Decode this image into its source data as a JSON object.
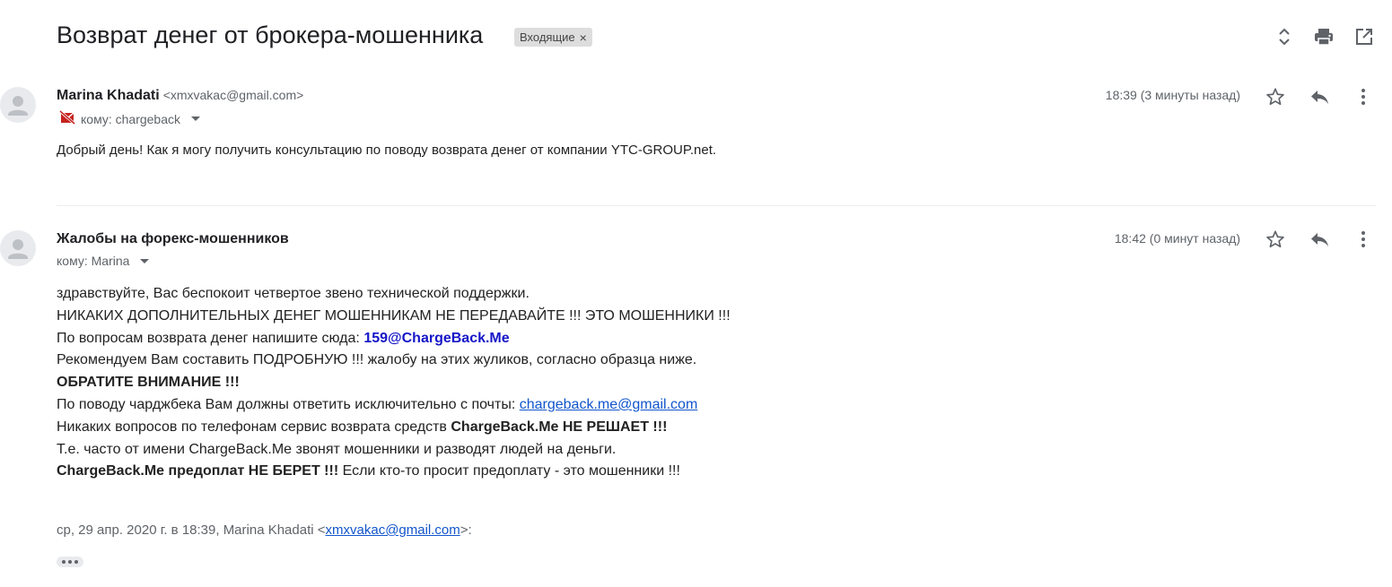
{
  "thread": {
    "subject": "Возврат денег от брокера-мошенника",
    "label": "Входящие",
    "label_remove": "×"
  },
  "toolbar": {
    "icons": [
      "expand-collapse-icon",
      "print-icon",
      "open-new-window-icon"
    ]
  },
  "messages": [
    {
      "sender_name": "Marina Khadati",
      "sender_email": "<xmxvakac@gmail.com>",
      "to": "кому: chargeback",
      "time": "18:39 (3 минуты назад)",
      "body": "Добрый день! Как я могу получить консультацию по поводу возврата денег от компании YTC-GROUP.net."
    },
    {
      "sender_name": "Жалобы на форекс-мошенников",
      "to": "кому: Marina",
      "time": "18:42 (0 минут назад)",
      "body": {
        "l1": "здравствуйте, Вас беспокоит четвертое звено технической поддержки.",
        "l2": "НИКАКИХ ДОПОЛНИТЕЛЬНЫХ ДЕНЕГ МОШЕННИКАМ НЕ ПЕРЕДАВАЙТЕ !!! ЭТО МОШЕННИКИ !!!",
        "l3_prefix": "По вопросам возврата денег напишите сюда: ",
        "l3_email": "159@ChargeBack.Me",
        "l4": "Рекомендуем Вам составить ПОДРОБНУЮ !!! жалобу на этих жуликов, согласно образца ниже.",
        "l5": "ОБРАТИТЕ ВНИМАНИЕ !!!",
        "l6_prefix": "По поводу чарджбека Вам должны ответить исключительно с почты: ",
        "l6_link": "chargeback.me@gmail.com",
        "l7_prefix": "Никаких вопросов по телефонам сервис возврата средств ",
        "l7_bold": "ChargeBack.Me НЕ РЕШАЕТ !!!",
        "l8": "Т.е. часто от имени ChargeBack.Me звонят мошенники и разводят людей на деньги.",
        "l9_bold": "ChargeBack.Me предоплат НЕ БЕРЕТ !!!",
        "l9_rest": " Если кто-то просит предоплату - это мошенники !!!"
      },
      "quote": {
        "prefix": "ср, 29 апр. 2020 г. в 18:39, Marina Khadati <",
        "link": "xmxvakac@gmail.com",
        "suffix": ">:"
      }
    }
  ],
  "colors": {
    "link": "#1155cc",
    "highlight_email": "#1515c8",
    "muted": "#5f6368"
  }
}
